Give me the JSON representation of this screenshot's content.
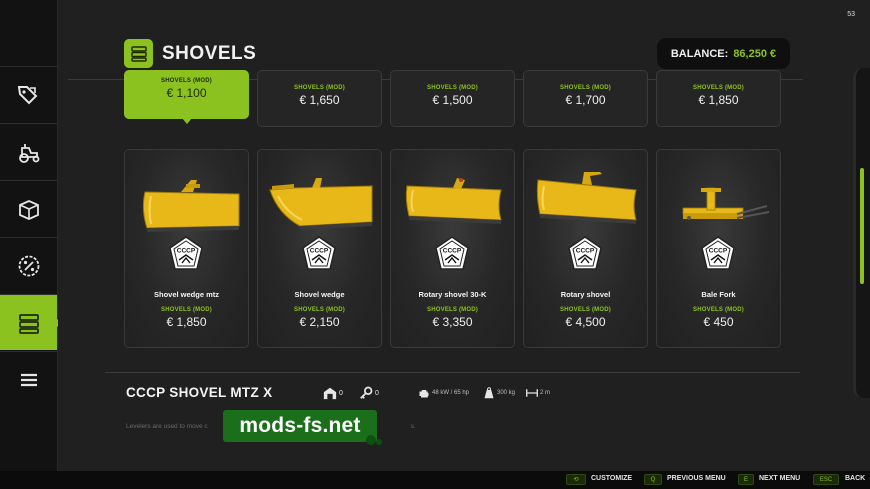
{
  "page": {
    "number": "53",
    "title": "SHOVELS"
  },
  "balance": {
    "label": "BALANCE:",
    "amount": "86,250 €"
  },
  "top_row": [
    {
      "category": "SHOVELS (MOD)",
      "price": "€ 1,100",
      "selected": true
    },
    {
      "category": "SHOVELS (MOD)",
      "price": "€ 1,650"
    },
    {
      "category": "SHOVELS (MOD)",
      "price": "€ 1,500"
    },
    {
      "category": "SHOVELS (MOD)",
      "price": "€ 1,700"
    },
    {
      "category": "SHOVELS (MOD)",
      "price": "€ 1,850"
    }
  ],
  "items": [
    {
      "name": "Shovel wedge mtz",
      "category": "SHOVELS (MOD)",
      "price": "€ 1,850",
      "brand_icon": "cccp-logo-icon"
    },
    {
      "name": "Shovel wedge",
      "category": "SHOVELS (MOD)",
      "price": "€ 2,150",
      "brand_icon": "cccp-logo-icon"
    },
    {
      "name": "Rotary shovel 30-K",
      "category": "SHOVELS (MOD)",
      "price": "€ 3,350",
      "brand_icon": "cccp-logo-icon"
    },
    {
      "name": "Rotary shovel",
      "category": "SHOVELS (MOD)",
      "price": "€ 4,500",
      "brand_icon": "cccp-logo-icon"
    },
    {
      "name": "Bale Fork",
      "category": "SHOVELS (MOD)",
      "price": "€ 450",
      "brand_icon": "cccp-logo-icon"
    }
  ],
  "brand_label": "CCCP",
  "detail": {
    "title": "CCCP SHOVEL MTZ X",
    "owned": "0",
    "leased": "0",
    "power": "48 kW / 65 hp",
    "weight": "300 kg",
    "width": "2 m",
    "description_start": "Levelers are used to move c",
    "description_end": "s."
  },
  "watermark": "mods-fs.net",
  "sidebar": [
    {
      "icon": "tag-price-icon"
    },
    {
      "icon": "tractor-icon"
    },
    {
      "icon": "box-icon"
    },
    {
      "icon": "percent-badge-icon"
    },
    {
      "icon": "list-shop-icon",
      "active": true
    },
    {
      "icon": "menu-lines-icon"
    }
  ],
  "footer": [
    {
      "key": "⟲",
      "label": "CUSTOMIZE"
    },
    {
      "key": "Q",
      "label": "PREVIOUS MENU"
    },
    {
      "key": "E",
      "label": "NEXT MENU"
    },
    {
      "key": "ESC",
      "label": "BACK"
    }
  ],
  "colors": {
    "accent": "#8cc21f",
    "implement_yellow": "#e8b818"
  }
}
